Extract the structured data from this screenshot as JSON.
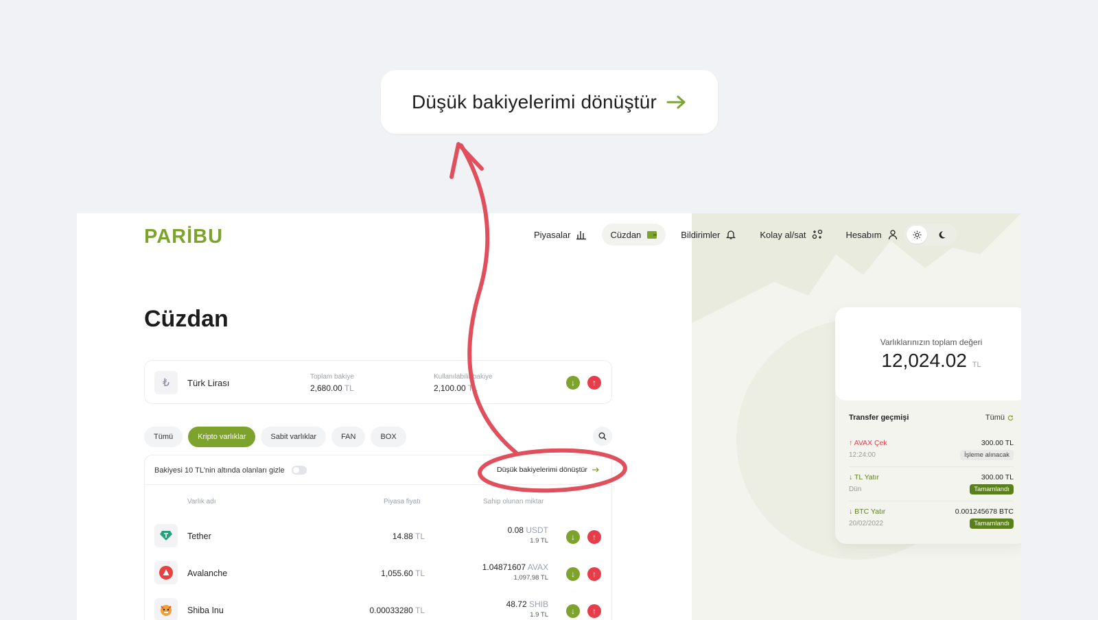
{
  "callout": {
    "text": "Düşük bakiyelerimi dönüştür"
  },
  "logo": "PARİBU",
  "nav": [
    {
      "label": "Piyasalar",
      "icon": "chart-icon"
    },
    {
      "label": "Cüzdan",
      "icon": "wallet-icon",
      "active": true
    },
    {
      "label": "Bildirimler",
      "icon": "bell-icon"
    },
    {
      "label": "Kolay al/sat",
      "icon": "swap-icon"
    },
    {
      "label": "Hesabım",
      "icon": "user-icon"
    }
  ],
  "page_title": "Cüzdan",
  "tl": {
    "symbol": "₺",
    "name": "Türk Lirası",
    "total_label": "Toplam bakiye",
    "total_value": "2,680.00",
    "total_unit": "TL",
    "avail_label": "Kullanılabilir bakiye",
    "avail_value": "2,100.00",
    "avail_unit": "TL"
  },
  "filters": [
    "Tümü",
    "Kripto varlıklar",
    "Sabit varlıklar",
    "FAN",
    "BOX"
  ],
  "active_filter": "Kripto varlıklar",
  "table": {
    "hide_label": "Bakiyesi 10 TL'nin altında olanları gizle",
    "convert_label": "Düşük bakiyelerimi dönüştür",
    "headers": {
      "name": "Varlık adı",
      "price": "Piyasa fiyatı",
      "amount": "Sahip olunan miktar"
    },
    "rows": [
      {
        "name": "Tether",
        "price": "14.88",
        "price_unit": "TL",
        "amount": "0.08",
        "amount_unit": "USDT",
        "amount_tl": "1.9 TL"
      },
      {
        "name": "Avalanche",
        "price": "1,055.60",
        "price_unit": "TL",
        "amount": "1.04871607",
        "amount_unit": "AVAX",
        "amount_tl": "1,097.98 TL"
      },
      {
        "name": "Shiba Inu",
        "price": "0.00033280",
        "price_unit": "TL",
        "amount": "48.72",
        "amount_unit": "SHIB",
        "amount_tl": "1.9 TL"
      }
    ]
  },
  "summary": {
    "label": "Varlıklarınızın toplam değeri",
    "value": "12,024.02",
    "unit": "TL",
    "history_title": "Transfer geçmişi",
    "history_all": "Tümü",
    "transfers": [
      {
        "name": "AVAX Çek",
        "dir": "out",
        "time": "12:24:00",
        "amount": "300.00 TL",
        "status": "İşleme alınacak",
        "status_type": "pending"
      },
      {
        "name": "TL Yatır",
        "dir": "in",
        "time": "Dün",
        "amount": "300.00 TL",
        "status": "Tamamlandı",
        "status_type": "done"
      },
      {
        "name": "BTC Yatır",
        "dir": "in",
        "time": "20/02/2022",
        "amount": "0.001245678 BTC",
        "status": "Tamamlandı",
        "status_type": "done"
      }
    ]
  },
  "colors": {
    "brand_green": "#7ea32c",
    "red": "#e53e4a",
    "annotation": "#e0505c"
  }
}
